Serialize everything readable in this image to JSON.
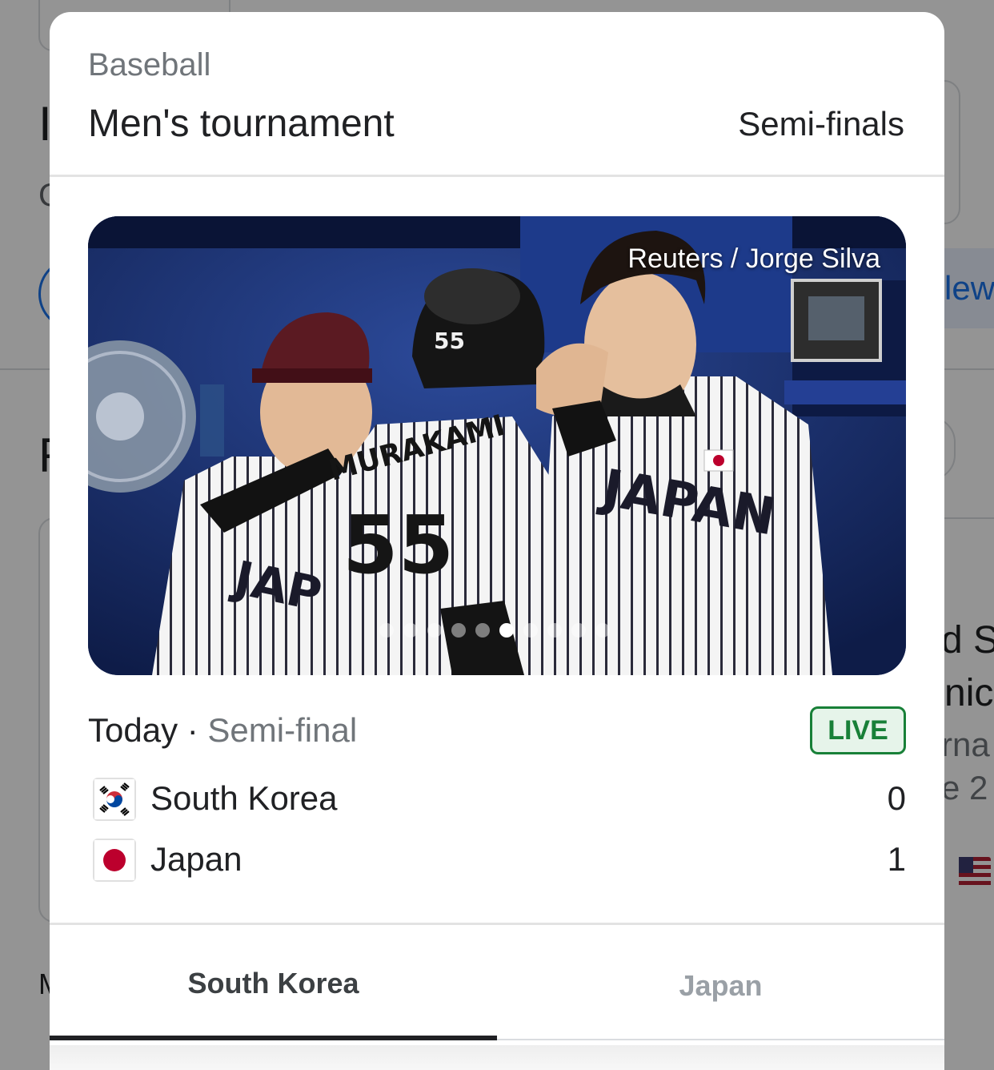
{
  "modal": {
    "sport": "Baseball",
    "event": "Men's tournament",
    "stage": "Semi-finals"
  },
  "photo": {
    "credit": "Reuters / Jorge Silva",
    "carousel_total": 10,
    "carousel_active": 6
  },
  "match": {
    "day": "Today",
    "separator": "·",
    "round": "Semi-final",
    "status": "LIVE",
    "teams": [
      {
        "name": "South Korea",
        "score": "0",
        "flag_icon": "south-korea-flag-icon"
      },
      {
        "name": "Japan",
        "score": "1",
        "flag_icon": "japan-flag-icon"
      }
    ]
  },
  "tabs": [
    {
      "label": "South Korea",
      "selected": true
    },
    {
      "label": "Japan",
      "selected": false
    }
  ],
  "colors": {
    "live_green": "#188038",
    "live_bg": "#e6f4ea",
    "muted_text": "#70757a",
    "tab_inactive": "#9aa0a6",
    "japan_red": "#bc002d",
    "korea_red": "#cd2e3a",
    "korea_blue": "#0047a0"
  }
}
